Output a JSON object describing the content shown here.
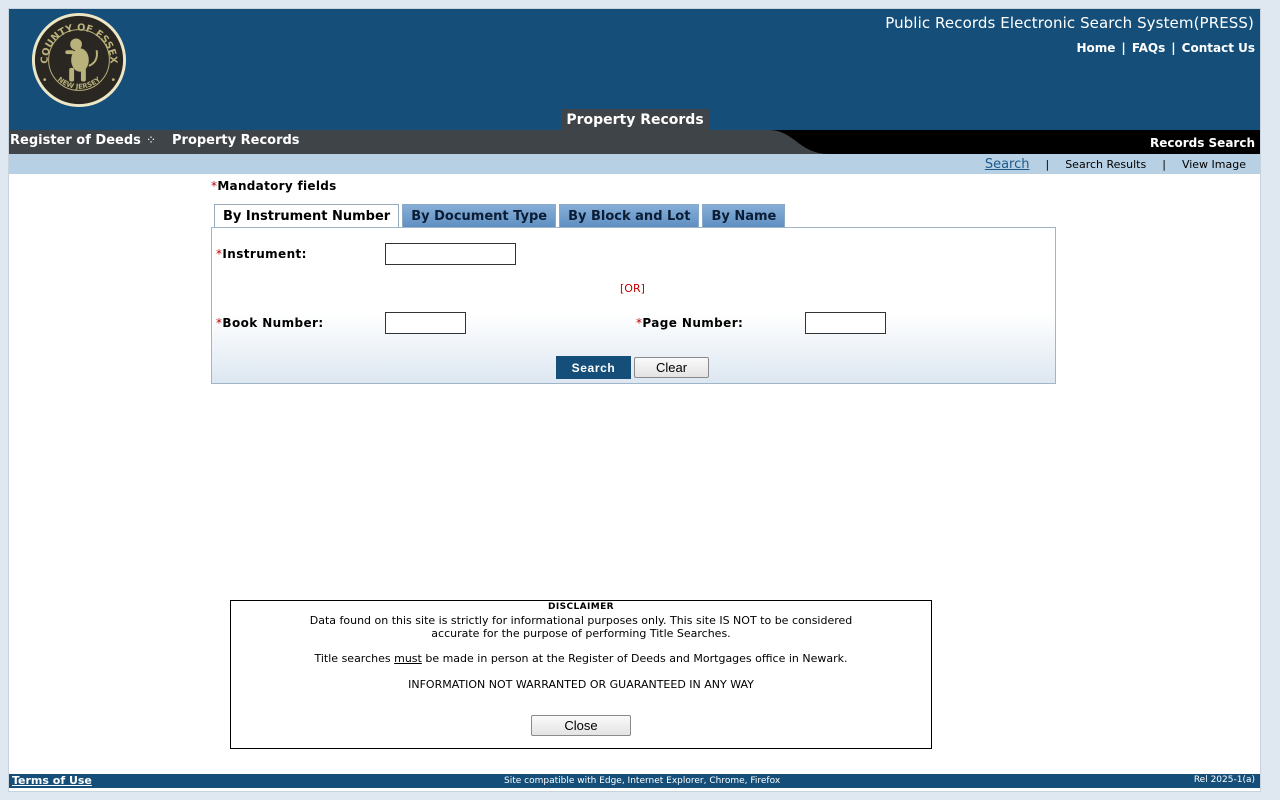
{
  "header": {
    "seal_text_top": "COUNTY OF ESSEX",
    "seal_text_bottom": "NEW JERSEY",
    "site_title": "Public Records Electronic Search System(PRESS)",
    "links": [
      "Home",
      "FAQs",
      "Contact Us"
    ],
    "link_separator": "|",
    "section_tab": "Property Records"
  },
  "navbar": {
    "register": "Register of Deeds",
    "property_records": "Property Records",
    "records_search": "Records Search"
  },
  "subnav": {
    "items": [
      "Search",
      "Search Results",
      "View Image"
    ],
    "separator": "|",
    "active": "Search"
  },
  "form": {
    "mandatory_star": "*",
    "mandatory_label": "Mandatory fields",
    "tabs": [
      "By Instrument Number",
      "By Document Type",
      "By Block and Lot",
      "By Name"
    ],
    "active_tab": "By Instrument Number",
    "instrument_label": "Instrument:",
    "instrument_value": "",
    "or_text": "[OR]",
    "book_label": "Book Number:",
    "book_value": "",
    "page_label": "Page Number:",
    "page_value": "",
    "search_button": "Search",
    "clear_button": "Clear"
  },
  "disclaimer": {
    "title": "DISCLAIMER",
    "line1": "Data found on this site is strictly for informational purposes only. This site IS NOT to be considered",
    "line2": "accurate for the purpose of performing Title Searches.",
    "line3_pre": "Title searches ",
    "line3_em": "must",
    "line3_post": " be made in person at the Register of Deeds and Mortgages office in Newark.",
    "line4": "INFORMATION NOT WARRANTED OR GUARANTEED IN ANY WAY",
    "close_button": "Close"
  },
  "footer": {
    "terms": "Terms of Use",
    "compat": "Site compatible with Edge, Internet Explorer, Chrome, Firefox",
    "release": "Rel 2025-1(a)"
  },
  "colors": {
    "header_blue": "#154f79",
    "nav_grey": "#3f4448",
    "subbar_blue": "#b7d0e3",
    "required_red": "#c00000",
    "seal_gold": "#b9b27a"
  }
}
